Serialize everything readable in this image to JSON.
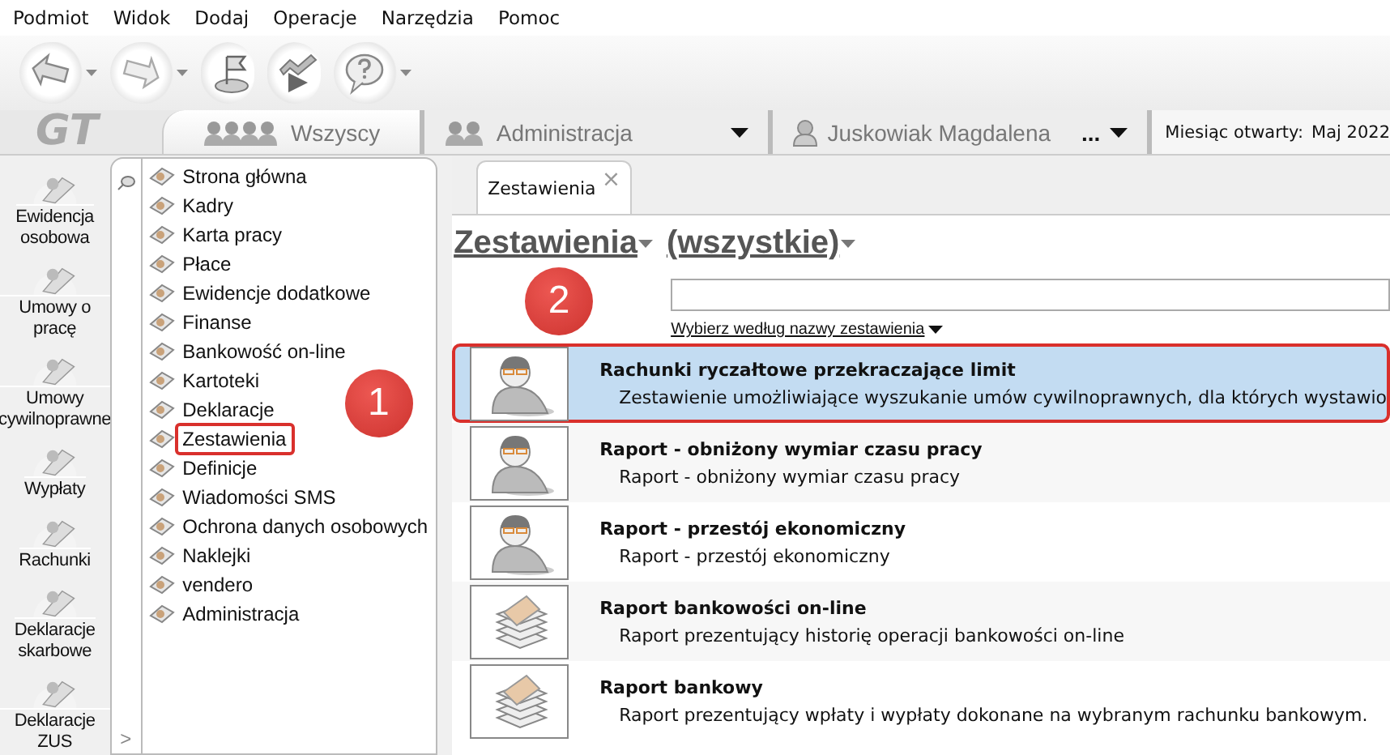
{
  "menu_bar": [
    "Podmiot",
    "Widok",
    "Dodaj",
    "Operacje",
    "Narzędzia",
    "Pomoc"
  ],
  "toolbar": [
    {
      "kind": "back",
      "has_menu": true
    },
    {
      "kind": "forward",
      "has_menu": true
    },
    {
      "kind": "flag",
      "has_menu": false
    },
    {
      "kind": "chart",
      "has_menu": false
    },
    {
      "kind": "help",
      "has_menu": true
    }
  ],
  "logo": "GT",
  "context_tabs": [
    {
      "kind": "group",
      "label": "Wszyscy",
      "selected": true,
      "has_menu": false
    },
    {
      "kind": "group",
      "label": "Administracja",
      "selected": false,
      "has_menu": true
    },
    {
      "kind": "person",
      "label": "Juskowiak Magdalena",
      "extra": "...",
      "selected": false,
      "has_menu": true
    }
  ],
  "open_month": {
    "label": "Miesiąc otwarty:",
    "value": "Maj 2022"
  },
  "sidebar": {
    "items": [
      {
        "label": "Ewidencja\nosobowa"
      },
      {
        "label": "Umowy o pracę"
      },
      {
        "label": "Umowy\ncywilnoprawne"
      },
      {
        "label": "Wypłaty"
      },
      {
        "label": "Rachunki"
      },
      {
        "label": "Deklaracje\nskarbowe"
      },
      {
        "label": "Deklaracje ZUS"
      }
    ],
    "expand": ">"
  },
  "navigation": {
    "step_marker": "1",
    "items": [
      {
        "label": "Strona główna",
        "outlined": false
      },
      {
        "label": "Kadry",
        "outlined": false
      },
      {
        "label": "Karta pracy",
        "outlined": false
      },
      {
        "label": "Płace",
        "outlined": false
      },
      {
        "label": "Ewidencje dodatkowe",
        "outlined": false
      },
      {
        "label": "Finanse",
        "outlined": false
      },
      {
        "label": "Bankowość on-line",
        "outlined": false
      },
      {
        "label": "Kartoteki",
        "outlined": false
      },
      {
        "label": "Deklaracje",
        "outlined": false
      },
      {
        "label": "Zestawienia",
        "outlined": true
      },
      {
        "label": "Definicje",
        "outlined": false
      },
      {
        "label": "Wiadomości SMS",
        "outlined": false
      },
      {
        "label": "Ochrona danych osobowych",
        "outlined": false
      },
      {
        "label": "Naklejki",
        "outlined": false
      },
      {
        "label": "vendero",
        "outlined": false
      },
      {
        "label": "Administracja",
        "outlined": false
      }
    ]
  },
  "document_tab": {
    "label": "Zestawienia",
    "close": "×"
  },
  "heading": {
    "category": "Zestawienia",
    "filter": "(wszystkie)"
  },
  "search": {
    "hint": "Wybierz według nazwy zestawienia"
  },
  "reports_step_marker": "2",
  "reports": [
    {
      "kind": "person",
      "title": "Rachunki ryczałtowe przekraczające limit",
      "description": "Zestawienie umożliwiające wyszukanie umów cywilnoprawnych, dla których wystawio",
      "selected": true,
      "outlined": true
    },
    {
      "kind": "person",
      "title": "Raport - obniżony wymiar czasu pracy",
      "description": "Raport - obniżony wymiar czasu pracy",
      "selected": false,
      "outlined": false
    },
    {
      "kind": "person",
      "title": "Raport - przestój ekonomiczny",
      "description": "Raport - przestój ekonomiczny",
      "selected": false,
      "outlined": false
    },
    {
      "kind": "money",
      "title": "Raport bankowości on-line",
      "description": "Raport prezentujący historię operacji bankowości on-line",
      "selected": false,
      "outlined": false
    },
    {
      "kind": "money",
      "title": "Raport bankowy",
      "description": "Raport prezentujący wpłaty i wypłaty dokonane na wybranym rachunku bankowym.",
      "selected": false,
      "outlined": false
    }
  ]
}
